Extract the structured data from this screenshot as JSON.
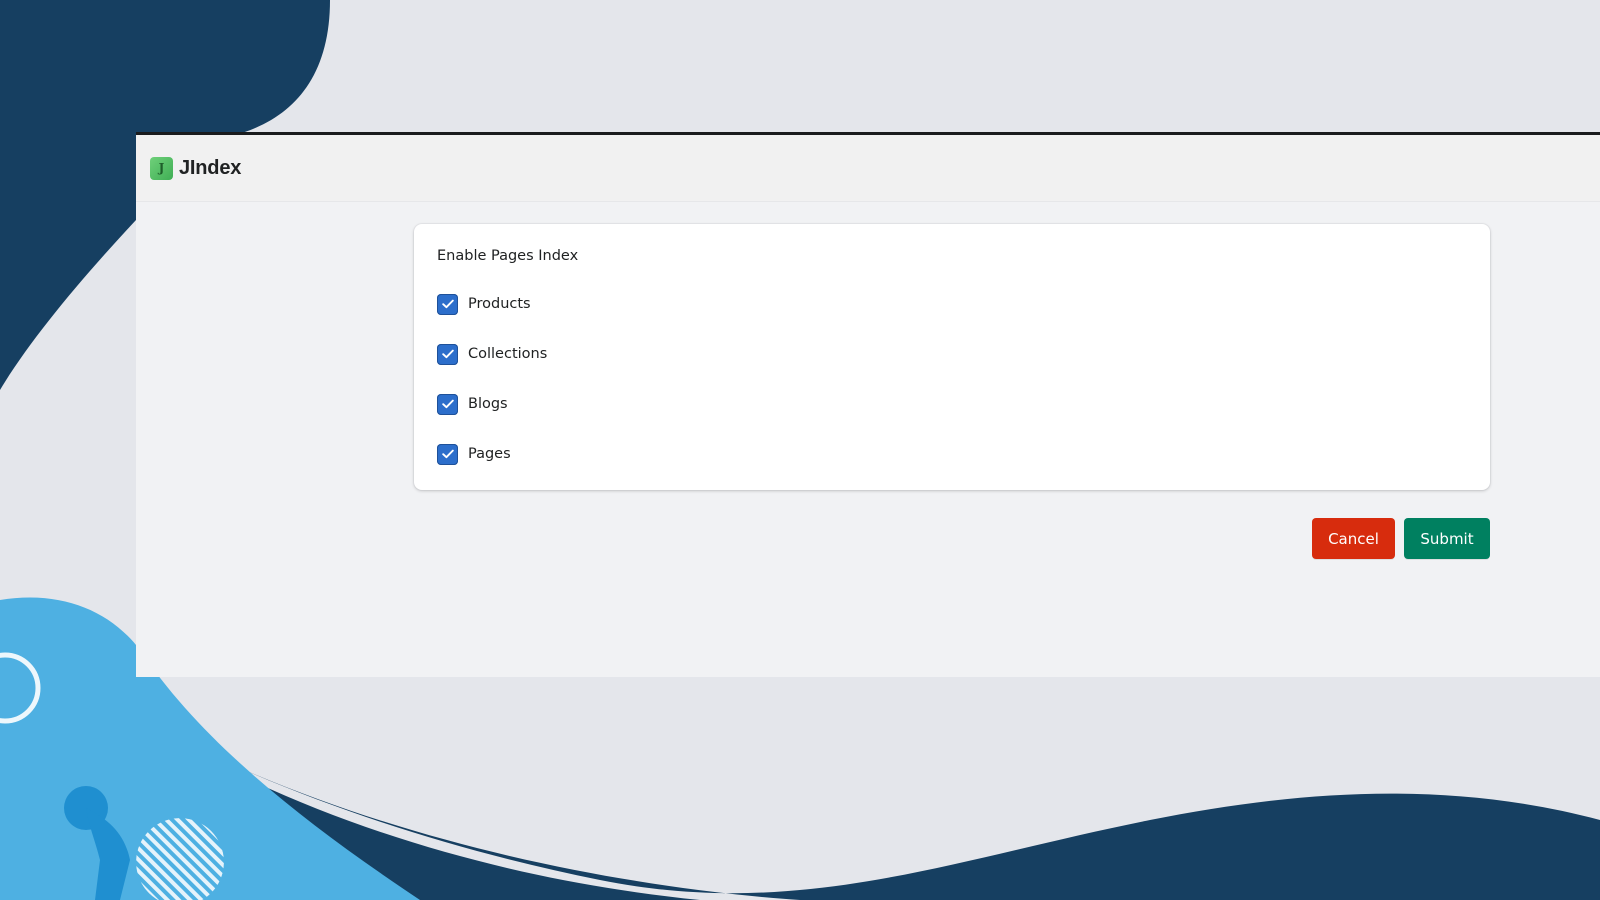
{
  "app": {
    "title": "JIndex",
    "logo_letter": "J"
  },
  "settings_card": {
    "heading": "Enable Pages Index",
    "options": [
      {
        "label": "Products",
        "checked": true
      },
      {
        "label": "Collections",
        "checked": true
      },
      {
        "label": "Blogs",
        "checked": true
      },
      {
        "label": "Pages",
        "checked": true
      }
    ]
  },
  "actions": {
    "cancel_label": "Cancel",
    "submit_label": "Submit"
  },
  "colors": {
    "checkbox": "#2c6ecb",
    "cancel": "#d72c0d",
    "submit": "#008060",
    "backdrop_dark": "#163f61",
    "backdrop_light": "#4eb0e2"
  },
  "icons": {
    "logo": "app-logo-icon",
    "check": "checkmark-icon"
  }
}
